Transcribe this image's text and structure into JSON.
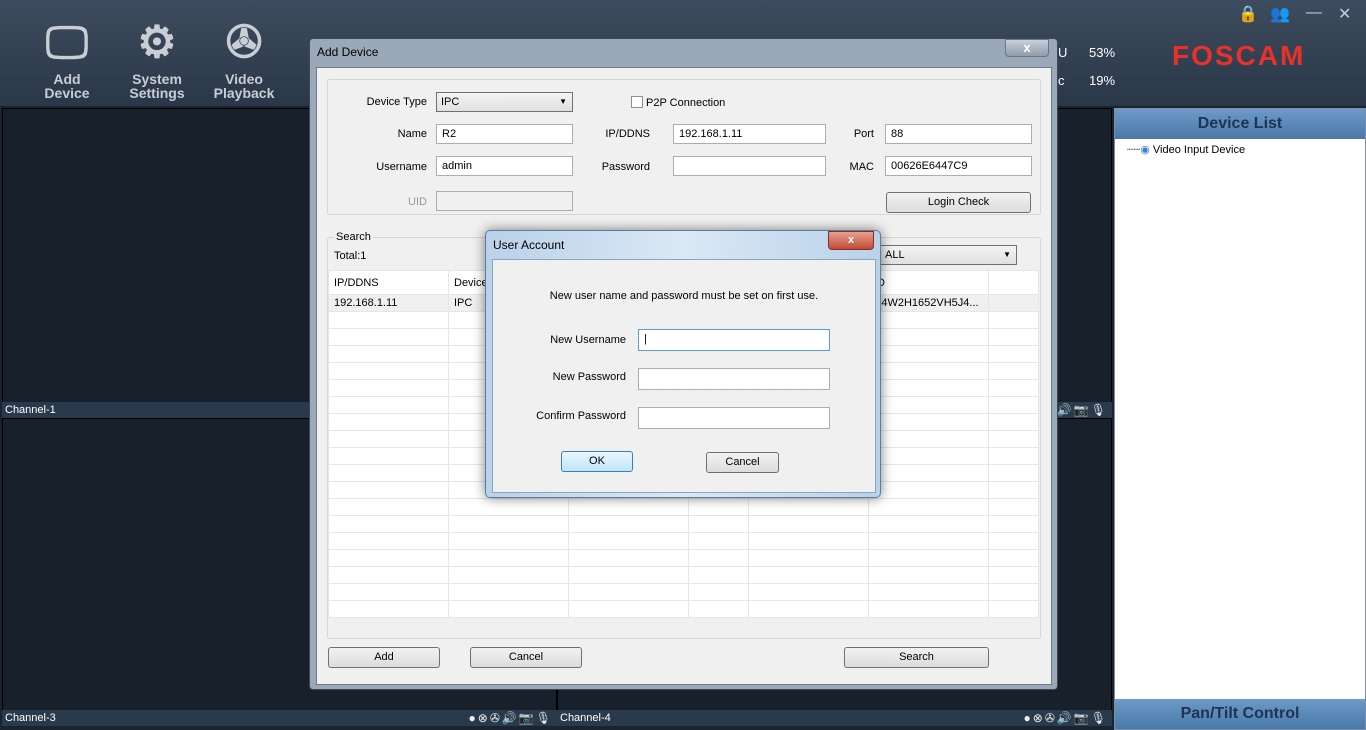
{
  "toolbar": {
    "buttons": [
      {
        "label1": "Add",
        "label2": "Device",
        "icon": "monitor-plus-icon"
      },
      {
        "label1": "System",
        "label2": "Settings",
        "icon": "gear-icon"
      },
      {
        "label1": "Video",
        "label2": "Playback",
        "icon": "film-reel-icon"
      }
    ]
  },
  "status": {
    "cpu_label": "U",
    "cpu": "53%",
    "net_label": "c",
    "net": "19%"
  },
  "brand": "FOSCAM",
  "channels": [
    "Channel-1",
    "Channel-3",
    "Channel-4"
  ],
  "device_list": {
    "title": "Device List",
    "items": [
      "Video Input Device"
    ]
  },
  "ptz_title": "Pan/Tilt Control",
  "add_device": {
    "title": "Add Device",
    "close": "x",
    "device_type_label": "Device Type",
    "device_type": "IPC",
    "p2p_label": "P2P Connection",
    "name_label": "Name",
    "name": "R2",
    "ip_label": "IP/DDNS",
    "ip": "192.168.1.11",
    "port_label": "Port",
    "port": "88",
    "username_label": "Username",
    "username": "admin",
    "password_label": "Password",
    "password": "",
    "mac_label": "MAC",
    "mac": "00626E6447C9",
    "uid_label": "UID",
    "uid": "",
    "login_check": "Login Check",
    "search_label": "Search",
    "total": "Total:1",
    "filter": "ALL",
    "columns": [
      "IP/DDNS",
      "Device",
      "",
      "",
      "",
      "ID",
      ""
    ],
    "rows": [
      [
        "192.168.1.11",
        "IPC",
        "",
        "",
        "",
        "V4W2H1652VH5J4...",
        ""
      ]
    ],
    "add": "Add",
    "cancel": "Cancel",
    "search": "Search"
  },
  "user_account": {
    "title": "User Account",
    "close": "x",
    "message": "New user name and password must be set on first use.",
    "new_username_label": "New Username",
    "new_password_label": "New Password",
    "confirm_password_label": "Confirm Password",
    "ok": "OK",
    "cancel": "Cancel"
  }
}
